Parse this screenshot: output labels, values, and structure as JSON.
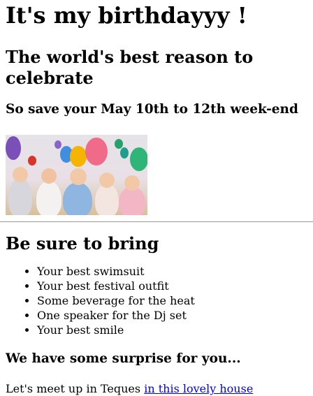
{
  "header": {
    "title": "It's my birthdayyy !",
    "subtitle": "The world's best reason to celebrate",
    "save_date": "So save your May 10th to 12th week-end"
  },
  "bring": {
    "heading": "Be sure to bring",
    "items": [
      "Your best swimsuit",
      "Your best festival outfit",
      "Some beverage for the heat",
      "One speaker for the Dj set",
      "Your best smile"
    ]
  },
  "surprise": {
    "heading": "We have some surprise for you..."
  },
  "meet": {
    "text": "Let's meet up in Teques ",
    "link_label": "in this lovely house"
  }
}
